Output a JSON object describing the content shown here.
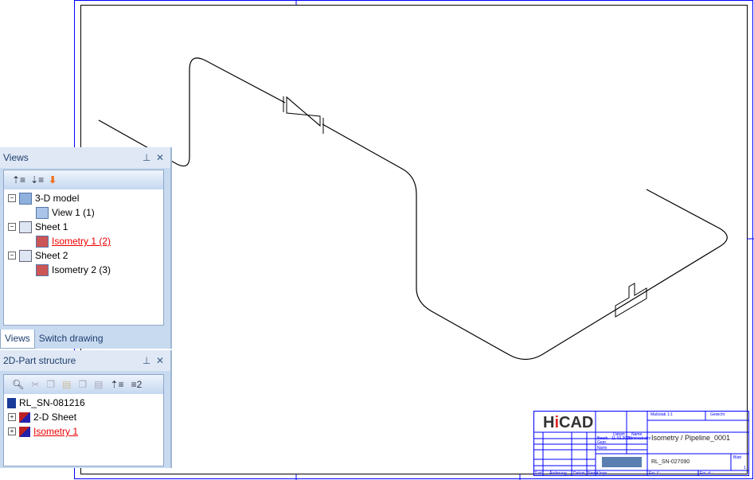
{
  "views_panel": {
    "title": "Views",
    "pin": "⊥",
    "close": "✕",
    "toolbar": [
      "collapse-all-icon",
      "expand-all-icon",
      "down-arrow-icon"
    ],
    "tree": [
      {
        "label": "3-D model",
        "level": 0,
        "expanded": true,
        "icon": "model-3d-icon"
      },
      {
        "label": "View 1 (1)",
        "level": 1,
        "icon": "view-icon"
      },
      {
        "label": "Sheet 1",
        "level": 0,
        "expanded": true,
        "icon": "sheet-icon"
      },
      {
        "label": "Isometry 1 (2)",
        "level": 1,
        "icon": "isometry-icon",
        "active": true
      },
      {
        "label": "Sheet 2",
        "level": 0,
        "expanded": true,
        "icon": "sheet-icon"
      },
      {
        "label": "Isometry 2 (3)",
        "level": 1,
        "icon": "isometry-icon"
      }
    ],
    "tabs": [
      "Views",
      "Switch drawing"
    ]
  },
  "part_panel": {
    "title": "2D-Part structure",
    "pin": "⊥",
    "close": "✕",
    "toolbar": [
      "preview-icon",
      "cut-icon",
      "copy-icon",
      "paste-icon",
      "copy-sheet-icon",
      "paste-sheet-icon",
      "collapse-icon",
      "numbering-icon"
    ],
    "numbering_label": "2",
    "root": "RL_SN-081216",
    "items": [
      {
        "label": "2-D Sheet"
      },
      {
        "label": "Isometry 1",
        "active": true
      }
    ]
  },
  "title_block": {
    "logo": "HiCAD",
    "scale": "Maßstab 1:1",
    "weight": "Gewicht",
    "date_hdr": "Datum",
    "name_hdr": "Name",
    "bearb": "Bearb.",
    "gepr": "Gepr.",
    "norm": "Norm",
    "date": "11.02.2015",
    "author": "Administrator",
    "title": "Isometry / Pipeline_0001",
    "drawing_no": "RL_SN-027090",
    "sheet": "Blatt",
    "sheet_no": "1",
    "zust": "Zust.",
    "aenderung": "Änderung",
    "datum": "Datum",
    "name": "Name",
    "urspr": "Urspr.",
    "ers_f": "Ers. f.:",
    "ers_d": "Ers. d.:"
  }
}
